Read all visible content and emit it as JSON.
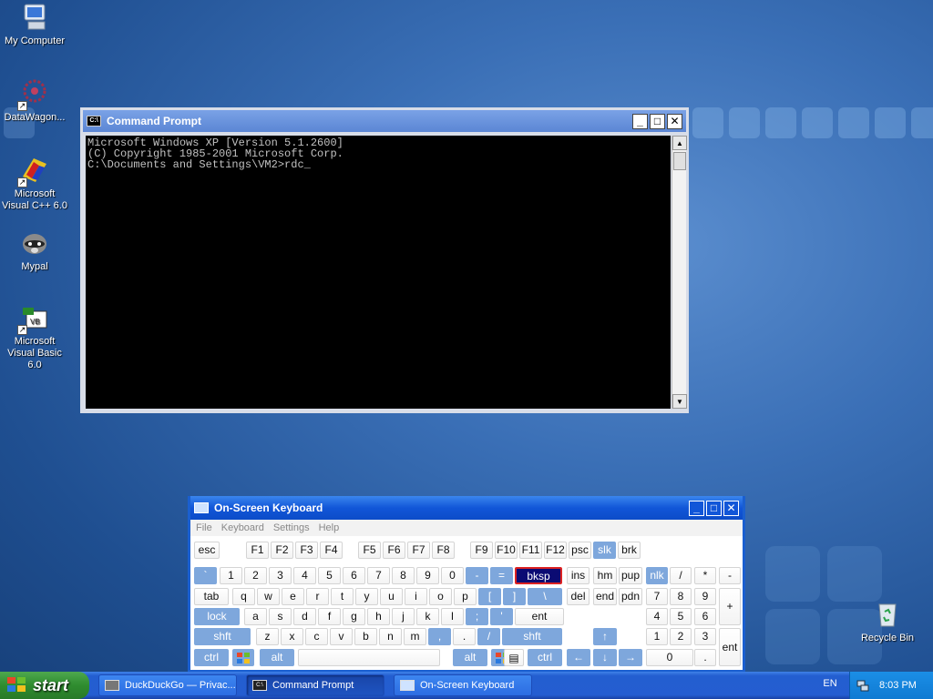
{
  "desktop": {
    "icons": [
      {
        "label": "My Computer"
      },
      {
        "label": "DataWagon..."
      },
      {
        "label": "Microsoft Visual C++ 6.0"
      },
      {
        "label": "Mypal"
      },
      {
        "label": "Microsoft Visual Basic 6.0"
      },
      {
        "label": "Recycle Bin"
      }
    ]
  },
  "cmd": {
    "title": "Command Prompt",
    "icon_text": "C:\\",
    "line1": "Microsoft Windows XP [Version 5.1.2600]",
    "line2": "(C) Copyright 1985-2001 Microsoft Corp.",
    "line3": "",
    "line4": "C:\\Documents and Settings\\VM2>rdc_"
  },
  "osk": {
    "title": "On-Screen Keyboard",
    "menu": [
      "File",
      "Keyboard",
      "Settings",
      "Help"
    ],
    "row1": [
      "esc",
      "F1",
      "F2",
      "F3",
      "F4",
      "F5",
      "F6",
      "F7",
      "F8",
      "F9",
      "F10",
      "F11",
      "F12",
      "psc",
      "slk",
      "brk"
    ],
    "row2": [
      "`",
      "1",
      "2",
      "3",
      "4",
      "5",
      "6",
      "7",
      "8",
      "9",
      "0",
      "-",
      "=",
      "bksp",
      "ins",
      "hm",
      "pup",
      "nlk",
      "/",
      "*",
      "-"
    ],
    "row3": [
      "tab",
      "q",
      "w",
      "e",
      "r",
      "t",
      "y",
      "u",
      "i",
      "o",
      "p",
      "[",
      "]",
      "\\",
      "del",
      "end",
      "pdn",
      "7",
      "8",
      "9",
      "+"
    ],
    "row4": [
      "lock",
      "a",
      "s",
      "d",
      "f",
      "g",
      "h",
      "j",
      "k",
      "l",
      ";",
      "'",
      "ent",
      "4",
      "5",
      "6"
    ],
    "row5": [
      "shft",
      "z",
      "x",
      "c",
      "v",
      "b",
      "n",
      "m",
      ",",
      ".",
      "/",
      "shft",
      "↑",
      "1",
      "2",
      "3",
      "ent"
    ],
    "row6": [
      "ctrl",
      "alt",
      "alt",
      "ctrl",
      "←",
      "↓",
      "→",
      "0",
      "."
    ]
  },
  "taskbar": {
    "start_label": "start",
    "tasks": [
      {
        "label": "DuckDuckGo — Privac..."
      },
      {
        "label": "Command Prompt"
      },
      {
        "label": "On-Screen Keyboard"
      }
    ],
    "lang": "EN",
    "clock": "8:03 PM"
  }
}
